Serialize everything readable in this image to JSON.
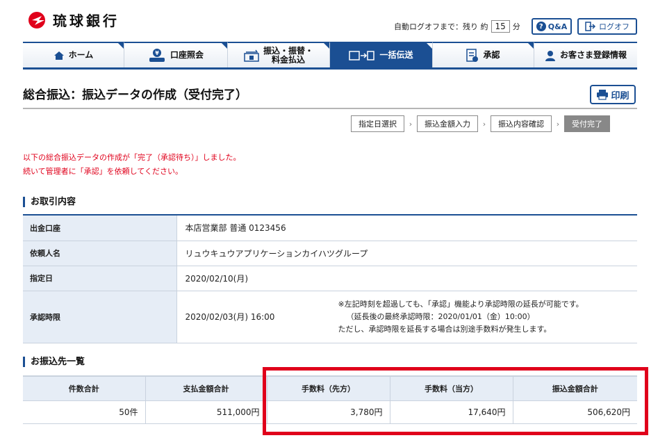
{
  "header": {
    "bank_name": "琉球銀行",
    "autologoff_label": "自動ログオフまで：残り 約",
    "autologoff_minutes": "15",
    "autologoff_unit": "分",
    "qa_label": "Q&A",
    "logoff_label": "ログオフ"
  },
  "nav": {
    "items": [
      {
        "label": "ホーム",
        "icon": "home-icon"
      },
      {
        "label": "口座照会",
        "icon": "account-inquiry-icon"
      },
      {
        "label": "振込・振替・\n料金払込",
        "icon": "transfer-icon"
      },
      {
        "label": "一括伝送",
        "icon": "bulk-transfer-icon"
      },
      {
        "label": "承認",
        "icon": "approval-icon"
      },
      {
        "label": "お客さま登録情報",
        "icon": "user-icon"
      }
    ],
    "active_index": 3
  },
  "page": {
    "title": "総合振込：振込データの作成（受付完了）",
    "print_label": "印刷"
  },
  "steps": [
    "指定日選択",
    "振込金額入力",
    "振込内容確認",
    "受付完了"
  ],
  "messages": [
    "以下の総合振込データの作成が「完了（承認待ち）」しました。",
    "続いて管理者に「承認」を依頼してください。"
  ],
  "details": {
    "heading": "お取引内容",
    "rows": [
      {
        "label": "出金口座",
        "value": "本店営業部 普通 0123456"
      },
      {
        "label": "依頼人名",
        "value": "リュウキュウアプリケーションカイハツグループ"
      },
      {
        "label": "指定日",
        "value": "2020/02/10(月)"
      }
    ],
    "approval": {
      "label": "承認時限",
      "value": "2020/02/03(月) 16:00",
      "notes": [
        "※左記時刻を超過しても、「承認」機能より承認時限の延長が可能です。",
        "（延長後の最終承認時限：2020/01/01（金）10:00）",
        "ただし、承認時限を延長する場合は別途手数料が発生します。"
      ]
    }
  },
  "summary": {
    "heading": "お振込先一覧",
    "headers": [
      "件数合計",
      "支払金額合計",
      "手数料（先方）",
      "手数料（当方）",
      "振込金額合計"
    ],
    "values": [
      "50件",
      "511,000円",
      "3,780円",
      "17,640円",
      "506,620円"
    ]
  },
  "colors": {
    "brand": "#1b4f93",
    "alert": "#e0001b",
    "label_bg": "#e6edf6"
  }
}
